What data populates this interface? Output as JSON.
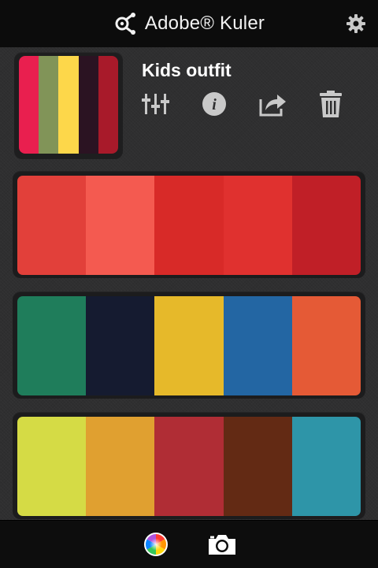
{
  "header": {
    "app_title": "Adobe® Kuler",
    "logo_icon": "kuler-logo-icon",
    "settings_icon": "gear-icon"
  },
  "theme": {
    "title": "Kids outfit",
    "thumbnail_colors": [
      "#e91f4f",
      "#819458",
      "#fdd74a",
      "#2b1322",
      "#a81a2a"
    ],
    "actions": [
      {
        "name": "edit",
        "icon": "sliders-icon"
      },
      {
        "name": "info",
        "icon": "info-icon"
      },
      {
        "name": "share",
        "icon": "share-icon"
      },
      {
        "name": "delete",
        "icon": "trash-icon"
      }
    ]
  },
  "palettes": [
    {
      "colors": [
        "#e2403a",
        "#f45a50",
        "#d82a28",
        "#e0312f",
        "#c01f27"
      ]
    },
    {
      "colors": [
        "#1f7d5b",
        "#151b30",
        "#e6b92a",
        "#2366a3",
        "#e55a36"
      ]
    },
    {
      "colors": [
        "#d5db45",
        "#e0a030",
        "#b02d35",
        "#632a14",
        "#2e95a8"
      ]
    }
  ],
  "bottombar": {
    "items": [
      {
        "name": "color-wheel",
        "icon": "color-wheel-icon"
      },
      {
        "name": "camera",
        "icon": "camera-icon"
      }
    ]
  },
  "colors": {
    "header_bg": "#0c0c0c",
    "body_bg": "#2f2f30",
    "icon_gray": "#c9c9c9"
  }
}
